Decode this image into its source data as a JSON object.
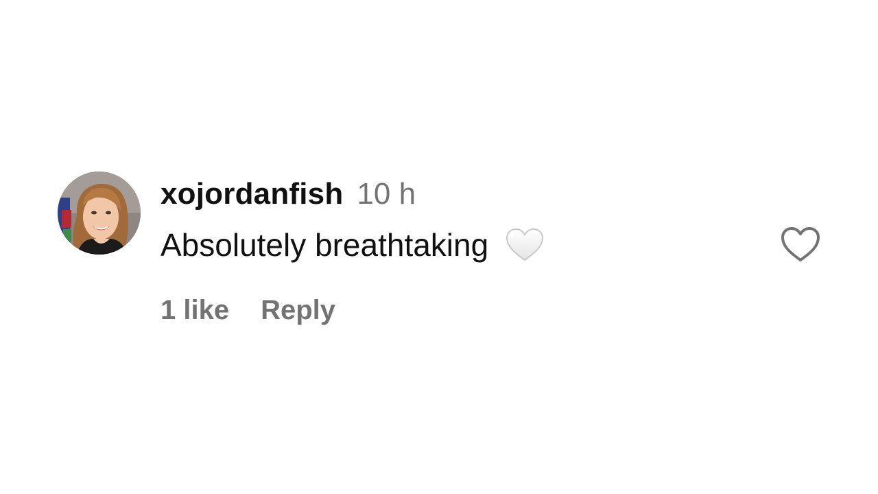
{
  "comment": {
    "username": "xojordanfish",
    "time": "10 h",
    "text": "Absolutely breathtaking",
    "emoji": "white-heart-emoji",
    "likes_label": "1 like",
    "reply_label": "Reply",
    "like_button_icon": "heart-outline-icon"
  },
  "colors": {
    "primary_text": "#111111",
    "secondary_text": "#737373",
    "background": "#ffffff"
  }
}
